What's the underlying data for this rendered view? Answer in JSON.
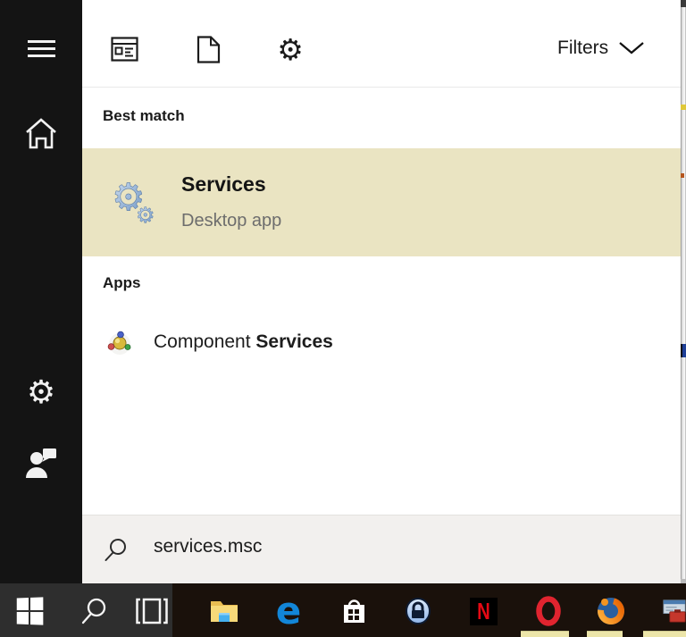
{
  "colors": {
    "highlight_row": "#eae4c2",
    "sidebar_bg": "#141414",
    "panel_bg": "#ffffff",
    "searchbox_bg": "#f2f0ee",
    "taskbar_left_bg": "#2e2e2e",
    "taskbar_right_bg": "#1a110b",
    "edge_blue": "#1286d8",
    "netflix_red": "#e50914",
    "subtitle_gray": "#6d6d6d"
  },
  "sidebar": {
    "items": [
      {
        "name": "menu",
        "icon": "hamburger-icon"
      },
      {
        "name": "home",
        "icon": "home-icon"
      },
      {
        "name": "settings",
        "icon": "gear-icon"
      },
      {
        "name": "account",
        "icon": "user-icon"
      }
    ]
  },
  "panel": {
    "filters_label": "Filters",
    "filter_icons": [
      "apps-filter-icon",
      "document-filter-icon",
      "settings-filter-icon"
    ],
    "sections": {
      "best_match": {
        "label": "Best match"
      },
      "apps": {
        "label": "Apps"
      }
    },
    "best_match_result": {
      "title": "Services",
      "subtitle": "Desktop app",
      "icon": "services-gears-icon"
    },
    "apps_result": {
      "text_regular": "Component ",
      "text_bold": "Services",
      "icon": "component-services-icon"
    },
    "search_box": {
      "value": "services.msc",
      "icon": "search-icon"
    }
  },
  "taskbar": {
    "items": [
      {
        "name": "start",
        "icon": "windows-logo-icon"
      },
      {
        "name": "search",
        "icon": "search-icon"
      },
      {
        "name": "task-view",
        "icon": "task-view-icon"
      },
      {
        "name": "file-explorer",
        "icon": "folder-icon"
      },
      {
        "name": "edge",
        "icon": "edge-icon",
        "glyph": "e"
      },
      {
        "name": "store",
        "icon": "store-bag-icon"
      },
      {
        "name": "keepass",
        "icon": "padlock-icon"
      },
      {
        "name": "netflix",
        "icon": "netflix-icon",
        "glyph": "N"
      },
      {
        "name": "opera",
        "icon": "opera-icon"
      },
      {
        "name": "firefox",
        "icon": "firefox-icon"
      },
      {
        "name": "partial-app",
        "icon": "window-toolbox-icon"
      }
    ]
  }
}
